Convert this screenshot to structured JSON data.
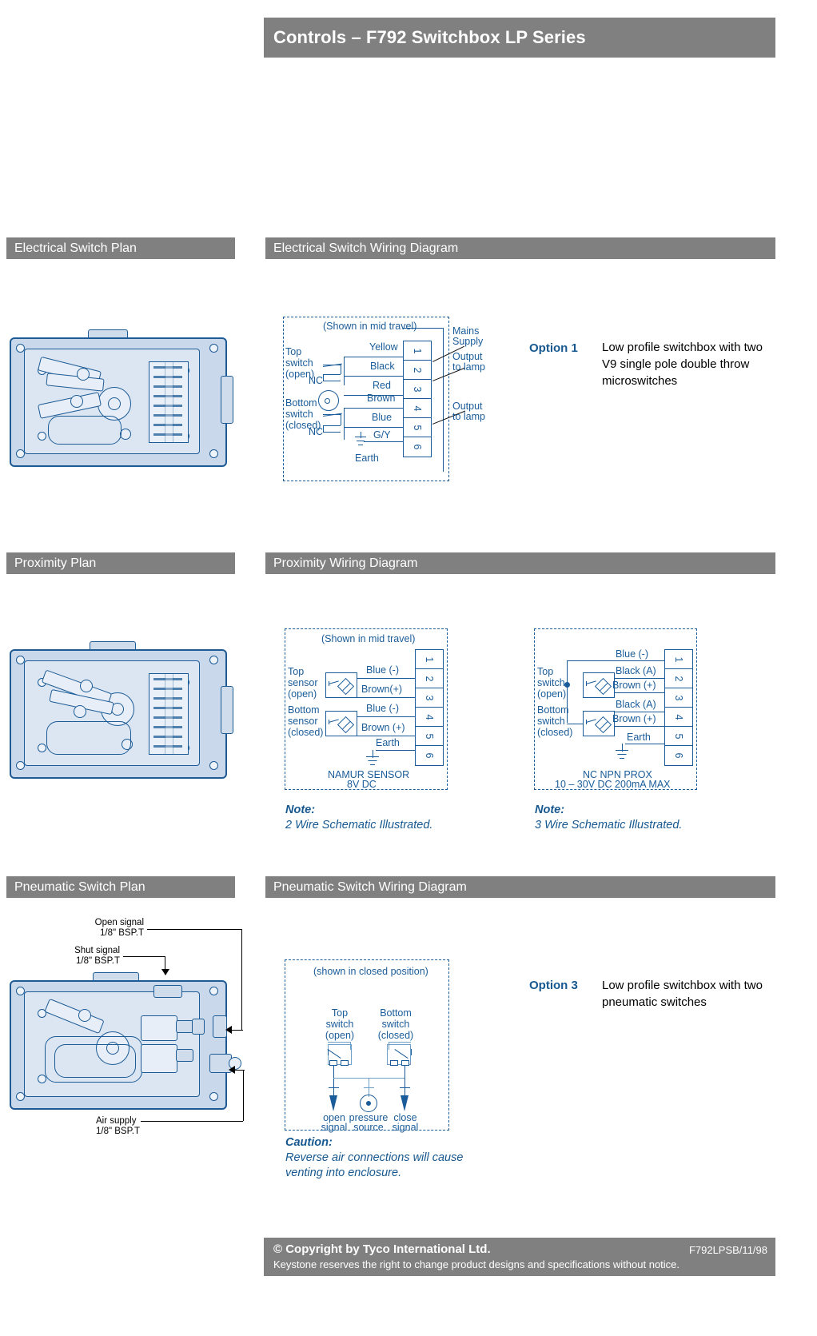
{
  "header": {
    "title": "Controls – F792 Switchbox LP Series"
  },
  "sections": {
    "electrical_plan": "Electrical Switch Plan",
    "electrical_wiring": "Electrical Switch Wiring Diagram",
    "proximity_plan": "Proximity Plan",
    "proximity_wiring": "Proximity Wiring Diagram",
    "pneumatic_plan": "Pneumatic Switch Plan",
    "pneumatic_wiring": "Pneumatic Switch Wiring Diagram"
  },
  "electrical": {
    "caption": "(Shown in mid travel)",
    "top_switch": {
      "l1": "Top",
      "l2": "switch",
      "l3": "(open)"
    },
    "bottom_switch": {
      "l1": "Bottom",
      "l2": "switch",
      "l3": "(closed)"
    },
    "nc_top": "NC",
    "nc_bottom": "NC",
    "wires": [
      "Yellow",
      "Black",
      "Red",
      "Brown",
      "Blue",
      "G/Y"
    ],
    "earth": "Earth",
    "terminals": [
      "1",
      "2",
      "3",
      "4",
      "5",
      "6"
    ],
    "callouts": {
      "mains": "Mains\nSupply",
      "output1": "Output\nto lamp",
      "output2": "Output\nto lamp"
    },
    "option_number": "Option 1",
    "option_desc": "Low profile switchbox with two V9 single pole double throw microswitches"
  },
  "proximity_2wire": {
    "caption": "(Shown in mid travel)",
    "top_sensor": {
      "l1": "Top",
      "l2": "sensor",
      "l3": "(open)"
    },
    "bottom_sensor": {
      "l1": "Bottom",
      "l2": "sensor",
      "l3": "(closed)"
    },
    "wires": [
      "Blue (-)",
      "Brown(+)",
      "Blue (-)",
      "Brown (+)"
    ],
    "earth": "Earth",
    "terminals": [
      "1",
      "2",
      "3",
      "4",
      "5",
      "6"
    ],
    "spec_line1": "NAMUR SENSOR",
    "spec_line2": "8V DC",
    "note_title": "Note:",
    "note_body": "2 Wire Schematic Illustrated."
  },
  "proximity_3wire": {
    "top_switch": {
      "l1": "Top",
      "l2": "switch",
      "l3": "(open)"
    },
    "bottom_switch": {
      "l1": "Bottom",
      "l2": "switch",
      "l3": "(closed)"
    },
    "wires": [
      "Blue (-)",
      "Black (A)",
      "Brown (+)",
      "Black (A)",
      "Brown (+)"
    ],
    "earth": "Earth",
    "terminals": [
      "1",
      "2",
      "3",
      "4",
      "5",
      "6"
    ],
    "spec_line1": "NC NPN PROX",
    "spec_line2": "10 – 30V DC  200mA MAX",
    "note_title": "Note:",
    "note_body": "3 Wire Schematic Illustrated."
  },
  "pneumatic_plan_callouts": {
    "open_signal": "Open signal\n1/8\" BSP.T",
    "shut_signal": "Shut signal\n1/8\" BSP.T",
    "air_supply": "Air supply\n1/8\" BSP.T"
  },
  "pneumatic": {
    "caption": "(shown in closed position)",
    "top_switch": {
      "l1": "Top",
      "l2": "switch",
      "l3": "(open)"
    },
    "bottom_switch": {
      "l1": "Bottom",
      "l2": "switch",
      "l3": "(closed)"
    },
    "ports": [
      {
        "l1": "open",
        "l2": "signal"
      },
      {
        "l1": "pressure",
        "l2": "source"
      },
      {
        "l1": "close",
        "l2": "signal"
      }
    ],
    "caution_title": "Caution:",
    "caution_body": "Reverse air connections will cause venting into enclosure.",
    "option_number": "Option 3",
    "option_desc": "Low profile switchbox with two pneumatic switches"
  },
  "footer": {
    "copyright": "© Copyright by Tyco International Ltd.",
    "code": "F792LPSB/11/98",
    "disclaimer": "Keystone reserves the right to change product designs and specifications without notice."
  },
  "colors": {
    "grey_bar": "#808080",
    "blue": "#1a5c99",
    "accent": "#16588f"
  }
}
